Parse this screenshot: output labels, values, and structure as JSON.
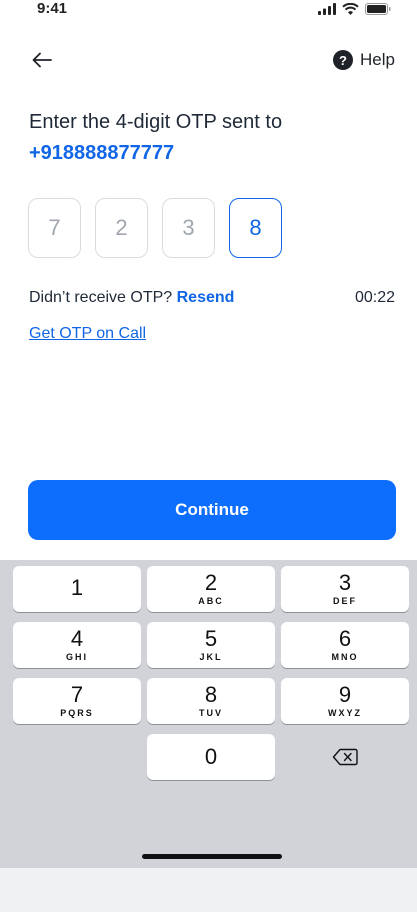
{
  "status_bar": {
    "time": "9:41"
  },
  "nav": {
    "help_label": "Help",
    "help_glyph": "?"
  },
  "prompt": {
    "heading": "Enter the 4-digit OTP sent to",
    "phone": "+918888877777"
  },
  "otp": {
    "digits": [
      "7",
      "2",
      "3",
      "8"
    ],
    "active_index": 3
  },
  "resend": {
    "prefix": "Didn’t receive OTP? ",
    "link": "Resend",
    "timer": "00:22"
  },
  "call_link": "Get OTP on Call",
  "continue_label": "Continue",
  "keypad": {
    "keys": [
      {
        "digit": "1",
        "letters": ""
      },
      {
        "digit": "2",
        "letters": "ABC"
      },
      {
        "digit": "3",
        "letters": "DEF"
      },
      {
        "digit": "4",
        "letters": "GHI"
      },
      {
        "digit": "5",
        "letters": "JKL"
      },
      {
        "digit": "6",
        "letters": "MNO"
      },
      {
        "digit": "7",
        "letters": "PQRS"
      },
      {
        "digit": "8",
        "letters": "TUV"
      },
      {
        "digit": "9",
        "letters": "WXYZ"
      },
      {
        "digit": "0",
        "letters": ""
      }
    ],
    "delete_icon": "backspace-icon"
  },
  "colors": {
    "accent": "#0d6efd",
    "link": "#1066e6",
    "keypad_bg": "#d1d3d9"
  }
}
